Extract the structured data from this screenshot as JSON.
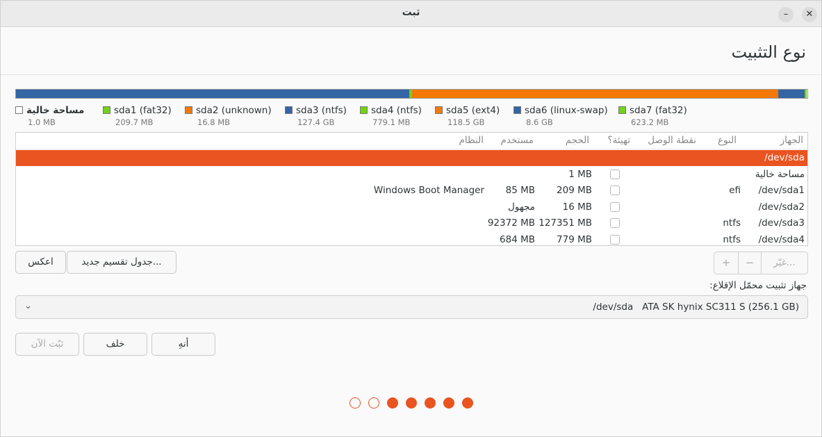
{
  "window": {
    "title": "ثبت",
    "minimize_glyph": "–",
    "close_glyph": "✕"
  },
  "page_title": "نوع التثبيت",
  "partition_bar": [
    {
      "name": "free",
      "color": "#ffffff",
      "fraction": 0.001
    },
    {
      "name": "sda1",
      "color": "#73d216",
      "fraction": 0.0018
    },
    {
      "name": "sda2",
      "color": "#f57900",
      "fraction": 0.0012
    },
    {
      "name": "sda3",
      "color": "#3465a4",
      "fraction": 0.497
    },
    {
      "name": "sda4",
      "color": "#73d216",
      "fraction": 0.003
    },
    {
      "name": "sda5",
      "color": "#f57900",
      "fraction": 0.4627
    },
    {
      "name": "sda6",
      "color": "#3465a4",
      "fraction": 0.0336
    },
    {
      "name": "sda7",
      "color": "#73d216",
      "fraction": 0.0024
    }
  ],
  "legend": [
    {
      "name": "مساحة خالية",
      "size": "1.0 MB",
      "color": "#ffffff"
    },
    {
      "name": "sda1 (fat32)",
      "size": "209.7 MB",
      "color": "#73d216"
    },
    {
      "name": "sda2 (unknown)",
      "size": "16.8 MB",
      "color": "#f57900"
    },
    {
      "name": "sda3 (ntfs)",
      "size": "127.4 GB",
      "color": "#3465a4"
    },
    {
      "name": "sda4 (ntfs)",
      "size": "779.1 MB",
      "color": "#73d216"
    },
    {
      "name": "sda5 (ext4)",
      "size": "118.5 GB",
      "color": "#f57900"
    },
    {
      "name": "sda6 (linux-swap)",
      "size": "8.6 GB",
      "color": "#3465a4"
    },
    {
      "name": "sda7 (fat32)",
      "size": "623.2 MB",
      "color": "#73d216"
    }
  ],
  "table": {
    "headers": {
      "device": "الجهاز",
      "type": "النوع",
      "mount": "نقطة الوصل",
      "format": "تهيئة؟",
      "size": "الحجم",
      "used": "مستخدم",
      "system": "النظام"
    },
    "rows": [
      {
        "device": "/dev/sda",
        "type": "",
        "size": "",
        "used": "",
        "system": "",
        "checkbox": false,
        "selected": true
      },
      {
        "device": "مساحة خالية",
        "type": "",
        "size": "1 MB",
        "used": "",
        "system": "",
        "checkbox": true,
        "selected": false
      },
      {
        "device": "/dev/sda1",
        "type": "efi",
        "size": "209 MB",
        "used": "85 MB",
        "system": "Windows Boot Manager",
        "checkbox": true,
        "selected": false
      },
      {
        "device": "/dev/sda2",
        "type": "",
        "size": "16 MB",
        "used": "مجهول",
        "system": "",
        "checkbox": true,
        "selected": false
      },
      {
        "device": "/dev/sda3",
        "type": "ntfs",
        "size": "127351 MB",
        "used": "92372 MB",
        "system": "",
        "checkbox": true,
        "selected": false
      },
      {
        "device": "/dev/sda4",
        "type": "ntfs",
        "size": "779 MB",
        "used": "684 MB",
        "system": "",
        "checkbox": true,
        "selected": false
      }
    ]
  },
  "controls": {
    "add": "+",
    "remove": "−",
    "change": "غيّر...",
    "new_table": "جدول تقسيم جديد...",
    "revert": "اعكس"
  },
  "boot_loader": {
    "label": "جهاز تثبيت محمّل الإقلاع:",
    "value": "/dev/sda   ATA SK hynix SC311 S (256.1 GB)"
  },
  "nav": {
    "quit": "أنهِ",
    "back": "خلف",
    "install": "ثبّت الآن"
  },
  "progress": {
    "steps": 7,
    "completed": 5
  },
  "colors": {
    "accent": "#e95420"
  }
}
